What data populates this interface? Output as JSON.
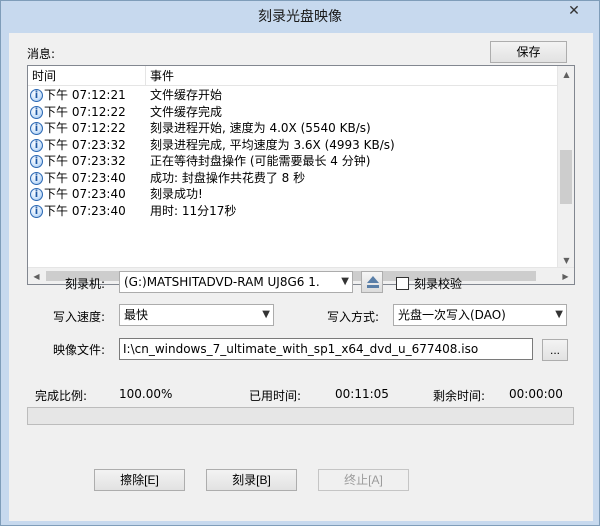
{
  "window": {
    "title": "刻录光盘映像",
    "close_glyph": "✕"
  },
  "messages": {
    "label": "消息:",
    "save_button": "保存",
    "columns": [
      "时间",
      "事件"
    ],
    "rows": [
      {
        "time": "下午 07:12:21",
        "event": "文件缓存开始"
      },
      {
        "time": "下午 07:12:22",
        "event": "文件缓存完成"
      },
      {
        "time": "下午 07:12:22",
        "event": "刻录进程开始, 速度为 4.0X (5540 KB/s)"
      },
      {
        "time": "下午 07:23:32",
        "event": "刻录进程完成, 平均速度为 3.6X (4993 KB/s)"
      },
      {
        "time": "下午 07:23:32",
        "event": "正在等待封盘操作 (可能需要最长 4 分钟)"
      },
      {
        "time": "下午 07:23:40",
        "event": "成功: 封盘操作共花费了 8 秒"
      },
      {
        "time": "下午 07:23:40",
        "event": "刻录成功!"
      },
      {
        "time": "下午 07:23:40",
        "event": "用时: 11分17秒"
      }
    ],
    "row_icon": "info-icon"
  },
  "burner": {
    "label": "刻录机:",
    "value": "(G:)MATSHITADVD-RAM UJ8G6   1.",
    "verify_label": "刻录校验",
    "verify_checked": false
  },
  "speed": {
    "label": "写入速度:",
    "value": "最快"
  },
  "write_mode": {
    "label": "写入方式:",
    "value": "光盘一次写入(DAO)"
  },
  "image_file": {
    "label": "映像文件:",
    "value": "I:\\cn_windows_7_ultimate_with_sp1_x64_dvd_u_677408.iso",
    "browse_label": "..."
  },
  "status": {
    "progress_label": "完成比例:",
    "progress_value": "100.00%",
    "elapsed_label": "已用时间:",
    "elapsed_value": "00:11:05",
    "remaining_label": "剩余时间:",
    "remaining_value": "00:00:00",
    "progress_fraction": 1.0
  },
  "buttons": {
    "erase": "擦除[E]",
    "burn": "刻录[B]",
    "stop": "终止[A]"
  }
}
